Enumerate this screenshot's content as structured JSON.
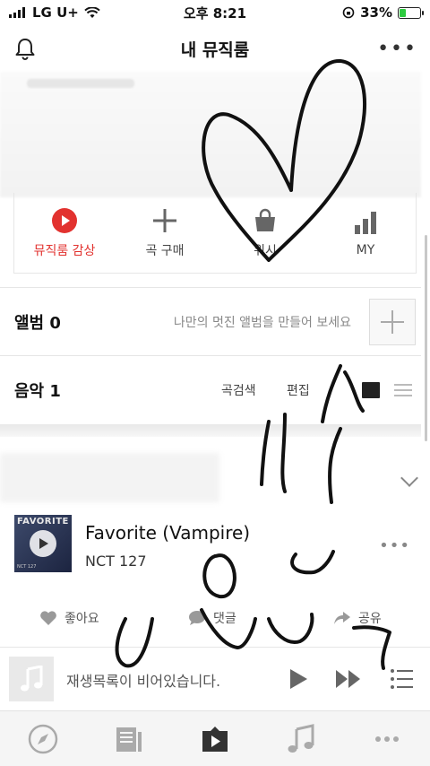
{
  "status_bar": {
    "carrier": "LG U+",
    "time": "오후 8:21",
    "battery": "33%",
    "battery_level": 0.33
  },
  "header": {
    "title": "내 뮤직룸",
    "bell_icon": "bell-icon",
    "more_icon": "more-horizontal-icon"
  },
  "quick_menu": [
    {
      "label": "뮤직룸 감상",
      "icon": "play-circle-icon",
      "color": "#e2322f"
    },
    {
      "label": "곡 구매",
      "icon": "plus-icon"
    },
    {
      "label": "위시",
      "icon": "shopping-bag-icon"
    },
    {
      "label": "MY",
      "icon": "bar-chart-icon"
    }
  ],
  "album_section": {
    "label": "앨범 0",
    "hint": "나만의 멋진 앨범을 만들어 보세요"
  },
  "music_section": {
    "label": "음악 1",
    "search": "곡검색",
    "edit": "편집"
  },
  "track": {
    "title": "Favorite (Vampire)",
    "artist": "NCT 127",
    "art_title": "FAVORITE",
    "art_label": "NCT 127"
  },
  "actions": {
    "like": "좋아요",
    "comment": "댓글",
    "share": "공유"
  },
  "player": {
    "empty_text": "재생목록이 비어있습니다."
  },
  "colors": {
    "accent": "#e2322f"
  }
}
